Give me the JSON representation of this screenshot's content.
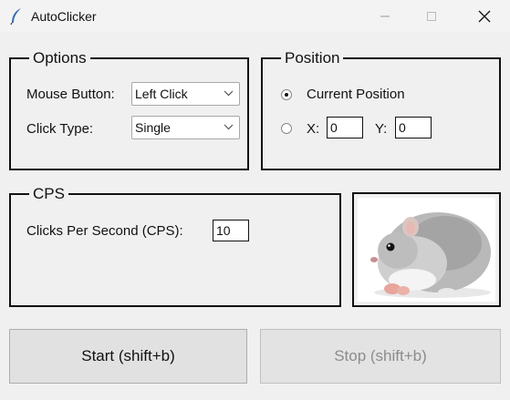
{
  "window": {
    "title": "AutoClicker",
    "app_icon": "feather-icon",
    "controls": [
      "minimize-icon",
      "maximize-icon",
      "close-icon"
    ]
  },
  "options": {
    "legend": "Options",
    "mouse_button_label": "Mouse Button:",
    "mouse_button_value": "Left Click",
    "click_type_label": "Click Type:",
    "click_type_value": "Single"
  },
  "position": {
    "legend": "Position",
    "current_position_label": "Current Position",
    "current_position_selected": true,
    "x_label": "X:",
    "x_value": "0",
    "y_label": "Y:",
    "y_value": "0"
  },
  "cps": {
    "legend": "CPS",
    "label": "Clicks Per Second (CPS):",
    "value": "10"
  },
  "buttons": {
    "start": "Start (shift+b)",
    "stop": "Stop (shift+b)"
  },
  "colors": {
    "background": "#f0f0f0",
    "disabled_text": "#8c8c8c"
  }
}
